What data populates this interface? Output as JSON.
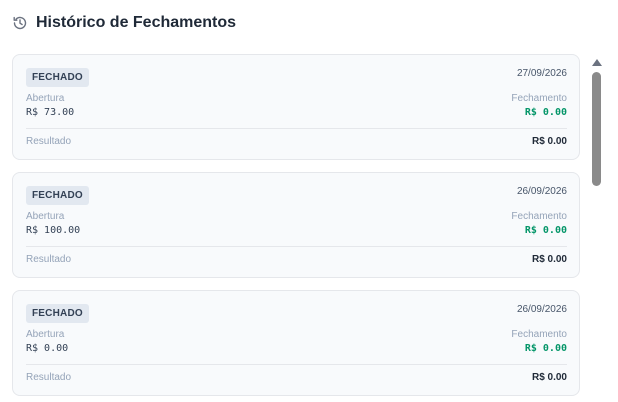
{
  "header": {
    "title": "Histórico de Fechamentos",
    "icon": "history-icon"
  },
  "labels": {
    "abertura": "Abertura",
    "fechamento": "Fechamento",
    "resultado": "Resultado"
  },
  "entries": [
    {
      "status": "FECHADO",
      "date": "27/09/2026",
      "abertura": "R$ 73.00",
      "fechamento": "R$ 0.00",
      "resultado": "R$ 0.00"
    },
    {
      "status": "FECHADO",
      "date": "26/09/2026",
      "abertura": "R$ 100.00",
      "fechamento": "R$ 0.00",
      "resultado": "R$ 0.00"
    },
    {
      "status": "FECHADO",
      "date": "26/09/2026",
      "abertura": "R$ 0.00",
      "fechamento": "R$ 0.00",
      "resultado": "R$ 0.00"
    }
  ],
  "colors": {
    "positive": "#059669",
    "badge_bg": "#e2e8f0",
    "card_bg": "#f8fafc"
  }
}
